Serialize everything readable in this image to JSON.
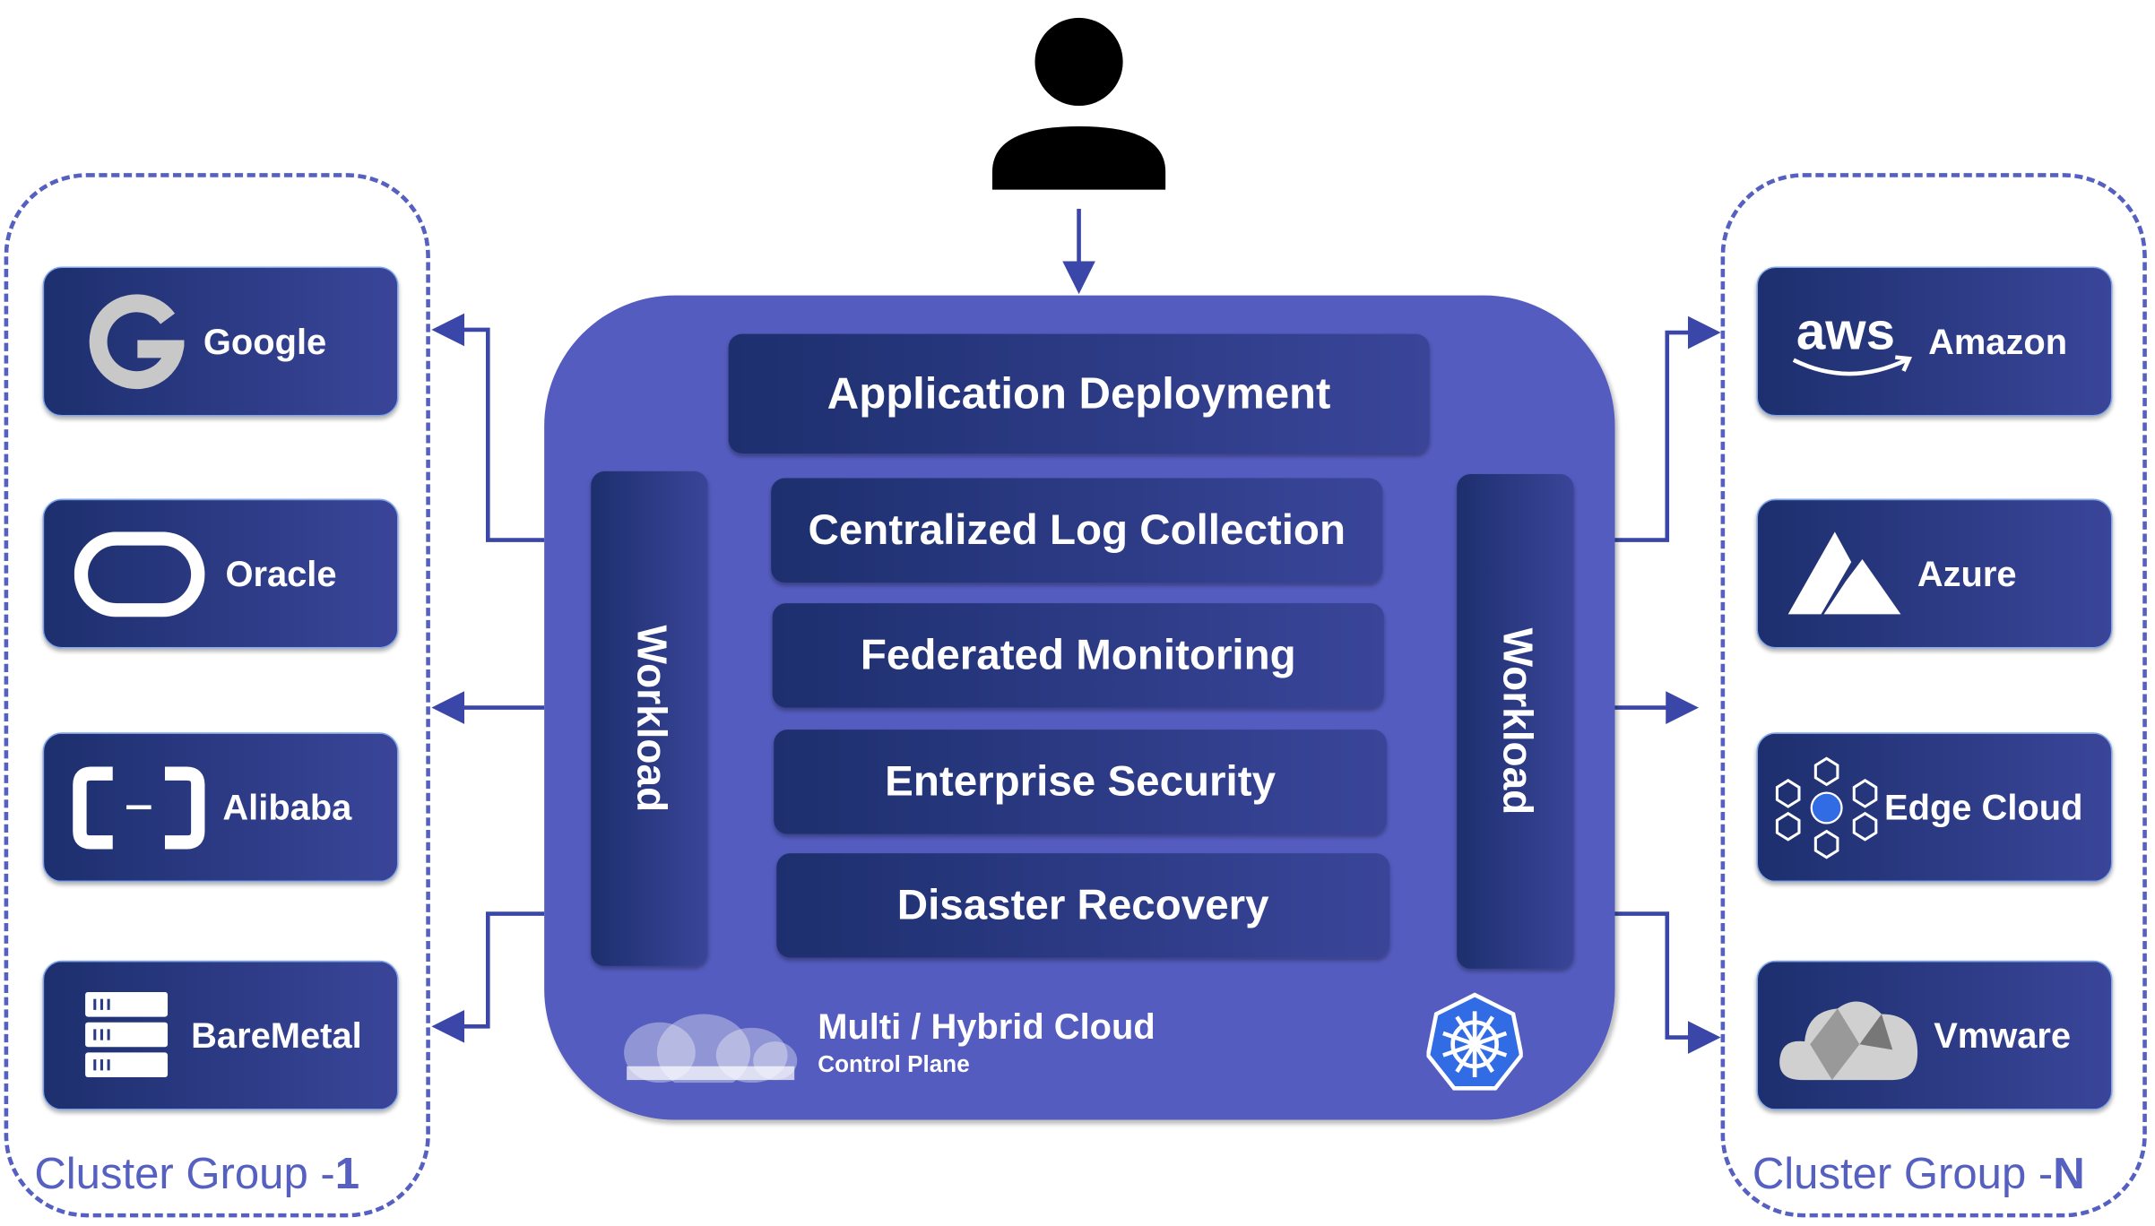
{
  "colors": {
    "accent": "#545cbf",
    "card_start": "#1d2f6e",
    "card_end": "#3a4599",
    "k8s": "#326ce5"
  },
  "user": {
    "icon": "person-icon"
  },
  "control_plane": {
    "modules": [
      "Application Deployment",
      "Centralized Log Collection",
      "Federated Monitoring",
      "Enterprise Security",
      "Disaster Recovery"
    ],
    "workload_left": "Workload",
    "workload_right": "Workload",
    "title": "Multi / Hybrid Cloud",
    "subtitle": "Control Plane",
    "logo_icon": "kubernetes-icon"
  },
  "group_left": {
    "label": "Cluster Group -",
    "number": "1",
    "providers": [
      {
        "name": "Google",
        "icon": "google-icon"
      },
      {
        "name": "Oracle",
        "icon": "oracle-icon"
      },
      {
        "name": "Alibaba",
        "icon": "alibaba-icon"
      },
      {
        "name": "BareMetal",
        "icon": "server-icon"
      }
    ]
  },
  "group_right": {
    "label": "Cluster Group -",
    "number": "N",
    "providers": [
      {
        "name": "Amazon",
        "icon": "aws-icon"
      },
      {
        "name": "Azure",
        "icon": "azure-icon"
      },
      {
        "name": "Edge Cloud",
        "icon": "edge-cloud-icon"
      },
      {
        "name": "Vmware",
        "icon": "vmware-icon"
      }
    ]
  }
}
